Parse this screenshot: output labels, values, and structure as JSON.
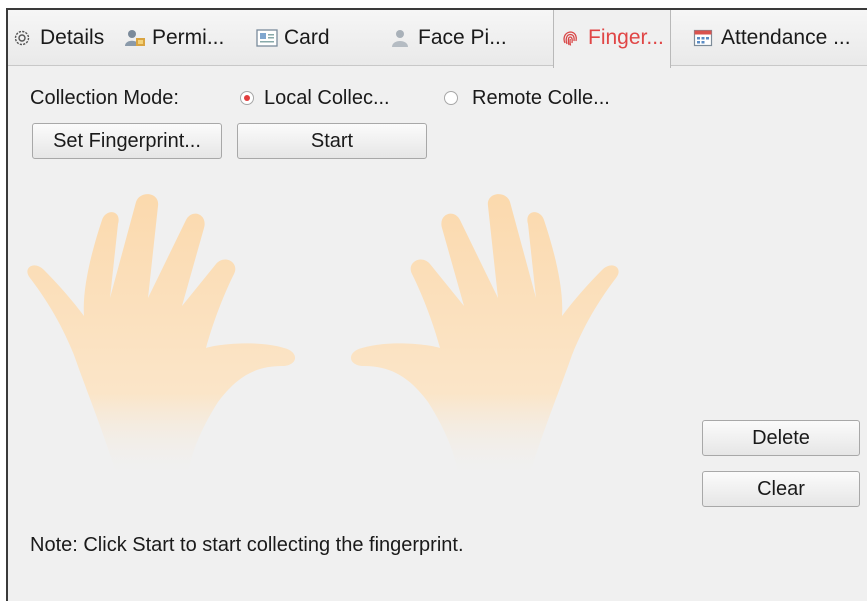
{
  "tabs": [
    {
      "label": "Details",
      "icon": "gear-icon"
    },
    {
      "label": "Permi...",
      "icon": "user-key-icon"
    },
    {
      "label": "Card",
      "icon": "card-icon"
    },
    {
      "label": "Face Pi...",
      "icon": "face-person-icon"
    },
    {
      "label": "Finger...",
      "icon": "fingerprint-icon",
      "active": true
    },
    {
      "label": "Attendance ...",
      "icon": "calendar-icon"
    }
  ],
  "collection": {
    "mode_label": "Collection Mode:",
    "local_label": "Local Collec...",
    "remote_label": "Remote Colle...",
    "selected": "local"
  },
  "buttons": {
    "set_fingerprint": "Set Fingerprint...",
    "start": "Start",
    "delete": "Delete",
    "clear": "Clear"
  },
  "note": "Note: Click Start to start collecting the fingerprint.",
  "colors": {
    "accent": "#e04646",
    "hand": "#fbd9ad"
  }
}
